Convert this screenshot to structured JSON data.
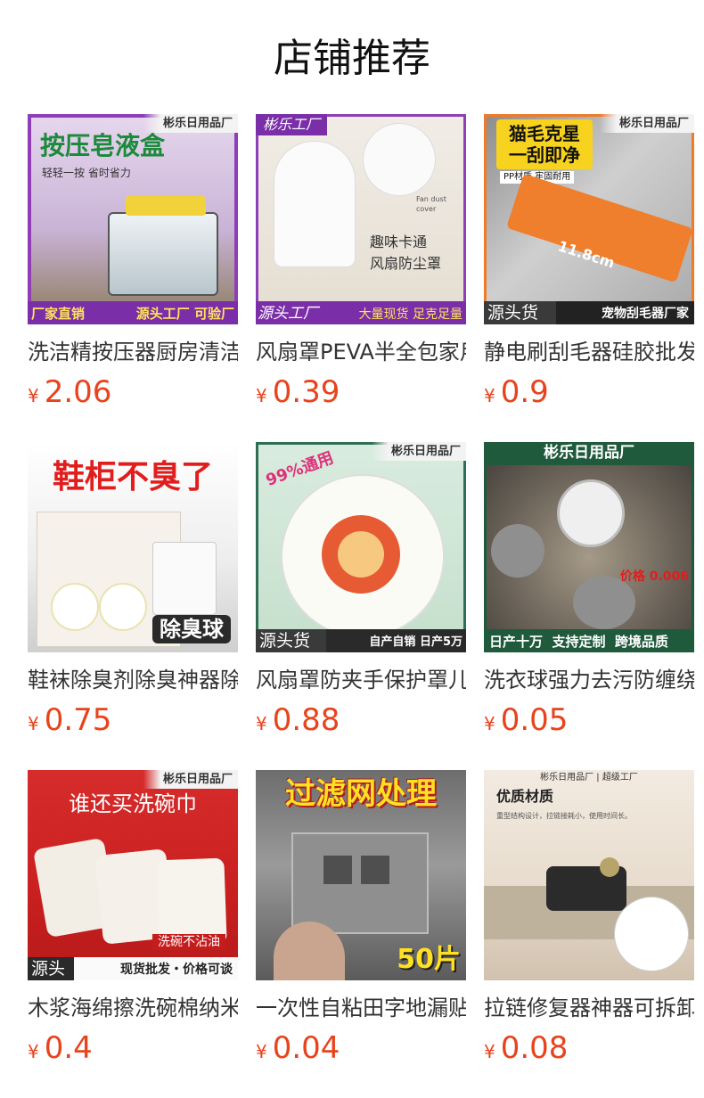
{
  "page": {
    "title": "店铺推荐"
  },
  "currency_symbol": "¥",
  "products": [
    {
      "name": "洗洁精按压器厨房清洁",
      "price": "2.06",
      "image": {
        "shop_tag": "彬乐日用品厂",
        "headline": "按压皂液盒",
        "sub": "轻轻一按 省时省力",
        "bottom_left": "厂家直销",
        "bottom_right": "源头工厂 可验厂"
      }
    },
    {
      "name": "风扇罩PEVA半全包家用",
      "price": "0.39",
      "image": {
        "shop_tag": "彬乐工厂",
        "headline": "趣味卡通\n风扇防尘罩",
        "caption": "Fan dust cover",
        "bottom_left": "源头工厂",
        "bottom_right": "大量现货 足克足量"
      }
    },
    {
      "name": "静电刷刮毛器硅胶批发",
      "price": "0.9",
      "image": {
        "shop_tag": "彬乐日用品厂",
        "headline": "猫毛克星\n一刮即净",
        "sub": "PP材质 牢固耐用",
        "measure": "11.8cm",
        "bottom_left": "源头货",
        "bottom_right": "宠物刮毛器厂家"
      }
    },
    {
      "name": "鞋袜除臭剂除臭神器除臭",
      "price": "0.75",
      "image": {
        "headline": "鞋柜不臭了",
        "badge": "除臭球"
      }
    },
    {
      "name": "风扇罩防夹手保护罩儿童",
      "price": "0.88",
      "image": {
        "shop_tag": "彬乐日用品厂",
        "ribbon": "99%通用",
        "bottom_left": "源头货",
        "bottom_right": "自产自销 日产5万"
      }
    },
    {
      "name": "洗衣球强力去污防缠绕",
      "price": "0.05",
      "image": {
        "shop_tag": "彬乐日用品厂",
        "price_tag": "价格 0.006",
        "bottom_text": "日产十万  支持定制  跨境品质"
      }
    },
    {
      "name": "木浆海绵擦洗碗棉纳米",
      "price": "0.4",
      "image": {
        "shop_tag": "彬乐日用品厂",
        "headline": "谁还买洗碗巾",
        "badge": "洗碗不沾油",
        "bottom_left": "源头",
        "bottom_right": "现货批发・价格可谈"
      }
    },
    {
      "name": "一次性自粘田字地漏贴",
      "price": "0.04",
      "image": {
        "headline": "过滤网处理",
        "badge": "50片"
      }
    },
    {
      "name": "拉链修复器神器可拆卸",
      "price": "0.08",
      "image": {
        "shop_tag": "彬乐日用品厂 | 超级工厂",
        "headline": "优质材质",
        "sub": "重型结构设计，拉链接耗小，使用时间长。"
      }
    }
  ],
  "colors": {
    "price": "#e8431c",
    "title": "#111111",
    "name": "#333333"
  }
}
